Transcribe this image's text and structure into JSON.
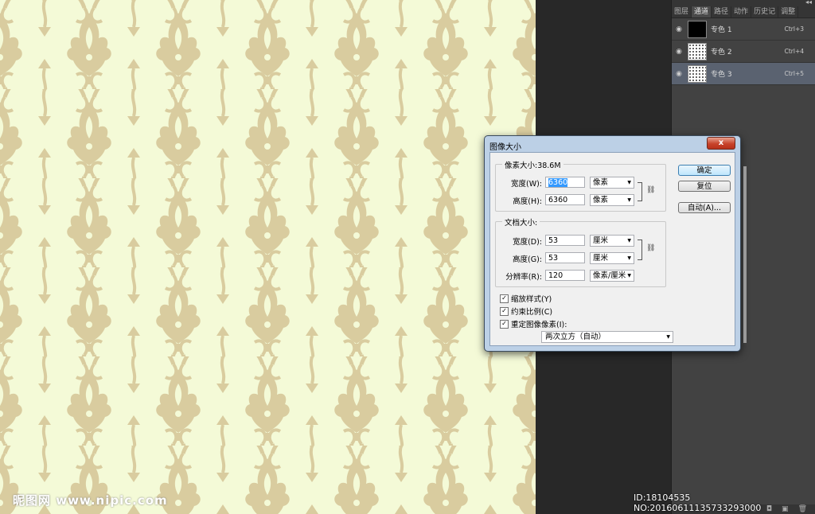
{
  "panel": {
    "tabs": [
      "图层",
      "通道",
      "路径",
      "动作",
      "历史记",
      "调整"
    ],
    "active_tab": 1,
    "collapse_icon": "double-chevron-icon",
    "channels": [
      {
        "name": "专色 1",
        "shortcut": "Ctrl+3",
        "thumb": "black"
      },
      {
        "name": "专色 2",
        "shortcut": "Ctrl+4",
        "thumb": "dots"
      },
      {
        "name": "专色 3",
        "shortcut": "Ctrl+5",
        "thumb": "dots"
      }
    ],
    "selected_channel": 2
  },
  "dialog": {
    "title": "图像大小",
    "close": "x",
    "pixel_group": {
      "label": "像素大小:38.6M",
      "width_label": "宽度(W):",
      "width_value": "6360",
      "width_unit": "像素",
      "height_label": "高度(H):",
      "height_value": "6360",
      "height_unit": "像素"
    },
    "doc_group": {
      "label": "文档大小:",
      "width_label": "宽度(D):",
      "width_value": "53",
      "width_unit": "厘米",
      "height_label": "高度(G):",
      "height_value": "53",
      "height_unit": "厘米",
      "res_label": "分辨率(R):",
      "res_value": "120",
      "res_unit": "像素/厘米"
    },
    "buttons": {
      "ok": "确定",
      "reset": "复位",
      "auto": "自动(A)..."
    },
    "checkboxes": [
      {
        "label": "缩放样式(Y)",
        "checked": true
      },
      {
        "label": "约束比例(C)",
        "checked": true
      },
      {
        "label": "重定图像像素(I):",
        "checked": true
      }
    ],
    "resample": "两次立方（自动）"
  },
  "watermark": {
    "left": "昵图网 www.nipic.com",
    "right": "ID:18104535 NO:20160611135733293000"
  },
  "colors": {
    "canvas_bg": "#f4fad7",
    "pattern": "#d7c9a0"
  }
}
